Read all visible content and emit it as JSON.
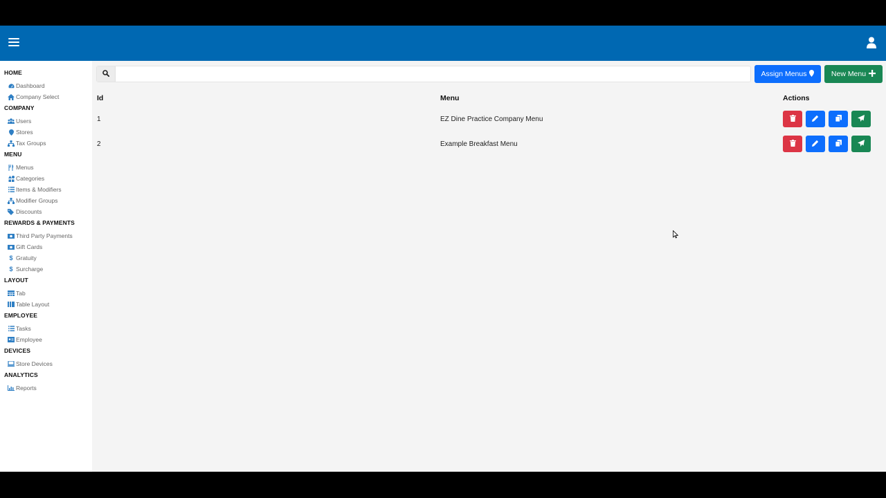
{
  "sidebar": {
    "sections": [
      {
        "title": "HOME",
        "items": [
          {
            "label": "Dashboard",
            "icon": "dashboard-icon"
          },
          {
            "label": "Company Select",
            "icon": "home-icon"
          }
        ]
      },
      {
        "title": "COMPANY",
        "items": [
          {
            "label": "Users",
            "icon": "users-icon"
          },
          {
            "label": "Stores",
            "icon": "map-pin-icon"
          },
          {
            "label": "Tax Groups",
            "icon": "sitemap-icon"
          }
        ]
      },
      {
        "title": "MENU",
        "items": [
          {
            "label": "Menus",
            "icon": "utensils-icon"
          },
          {
            "label": "Categories",
            "icon": "shapes-icon"
          },
          {
            "label": "Items & Modifiers",
            "icon": "list-icon"
          },
          {
            "label": "Modifier Groups",
            "icon": "sitemap-icon"
          },
          {
            "label": "Discounts",
            "icon": "tags-icon"
          }
        ]
      },
      {
        "title": "REWARDS & PAYMENTS",
        "items": [
          {
            "label": "Third Party Payments",
            "icon": "money-icon"
          },
          {
            "label": "Gift Cards",
            "icon": "money-icon"
          },
          {
            "label": "Gratuity",
            "icon": "dollar-icon"
          },
          {
            "label": "Surcharge",
            "icon": "dollar-icon"
          }
        ]
      },
      {
        "title": "LAYOUT",
        "items": [
          {
            "label": "Tab",
            "icon": "table-icon"
          },
          {
            "label": "Table Layout",
            "icon": "columns-icon"
          }
        ]
      },
      {
        "title": "EMPLOYEE",
        "items": [
          {
            "label": "Tasks",
            "icon": "tasks-icon"
          },
          {
            "label": "Employee",
            "icon": "id-card-icon"
          }
        ]
      },
      {
        "title": "DEVICES",
        "items": [
          {
            "label": "Store Devices",
            "icon": "laptop-icon"
          }
        ]
      },
      {
        "title": "ANALYTICS",
        "items": [
          {
            "label": "Reports",
            "icon": "chart-icon"
          }
        ]
      }
    ]
  },
  "search": {
    "placeholder": "",
    "value": ""
  },
  "toolbar": {
    "assign_label": "Assign Menus",
    "new_label": "New Menu"
  },
  "table": {
    "headers": {
      "id": "Id",
      "menu": "Menu",
      "actions": "Actions"
    },
    "rows": [
      {
        "id": "1",
        "menu": "EZ Dine Practice Company Menu"
      },
      {
        "id": "2",
        "menu": "Example Breakfast Menu"
      }
    ]
  },
  "colors": {
    "header": "#0068b2",
    "primary": "#0d6efd",
    "success": "#198754",
    "danger": "#dc3545",
    "icon": "#2f7fc4"
  }
}
